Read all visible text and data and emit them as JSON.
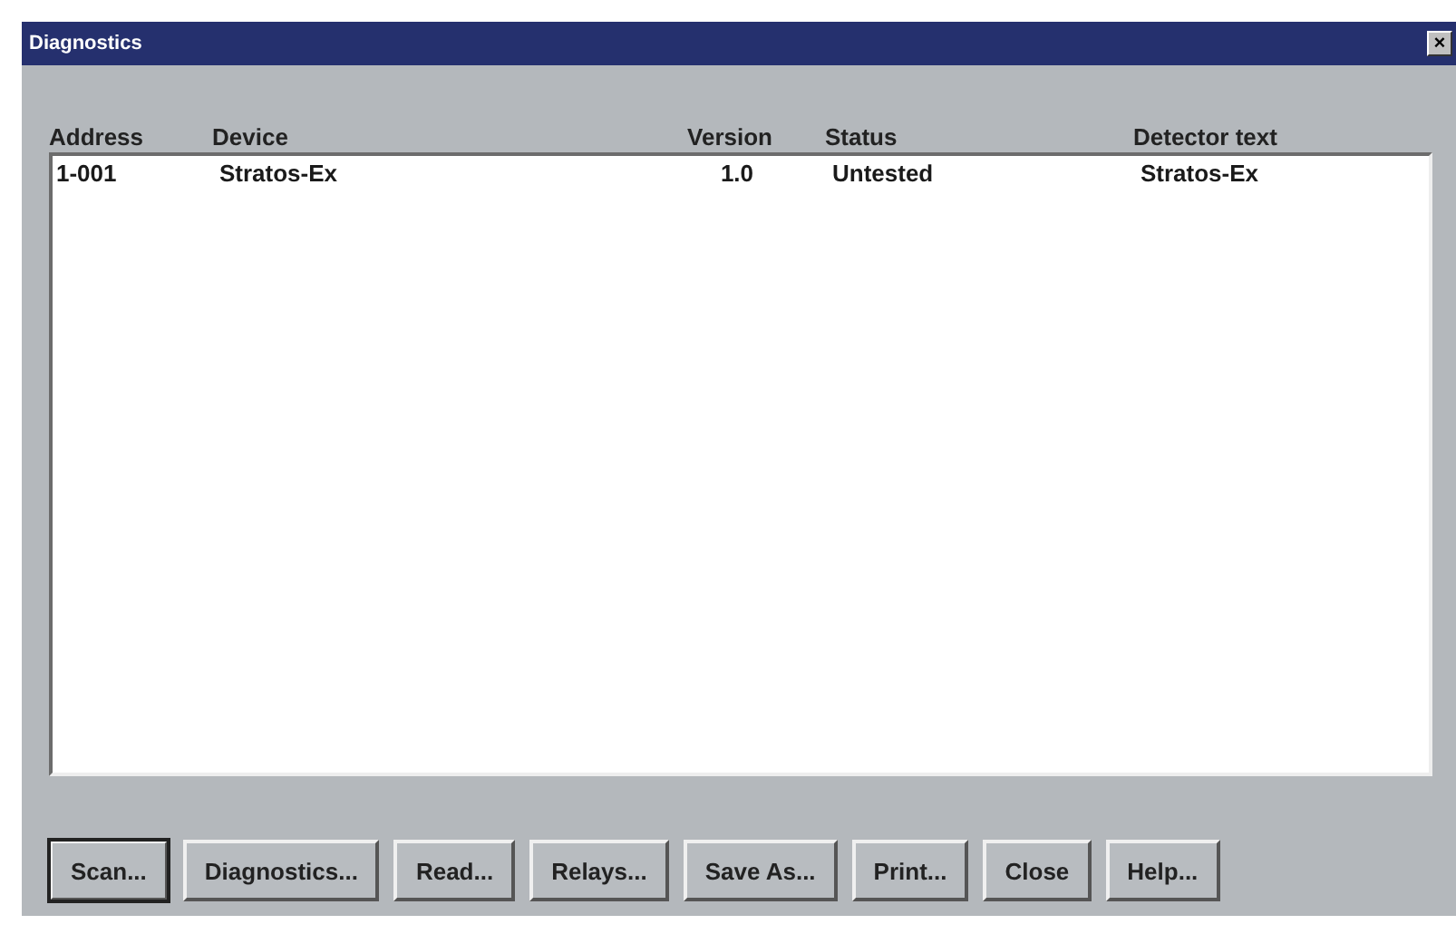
{
  "window": {
    "title": "Diagnostics",
    "close": "×"
  },
  "table": {
    "columns": [
      "Address",
      "Device",
      "Version",
      "Status",
      "Detector text"
    ],
    "rows": [
      {
        "cells": [
          "1-001",
          "Stratos-Ex",
          "1.0",
          "Untested",
          "Stratos-Ex"
        ]
      }
    ]
  },
  "buttons": [
    {
      "label": "Scan...",
      "default": true
    },
    {
      "label": "Diagnostics...",
      "default": false
    },
    {
      "label": "Read...",
      "default": false
    },
    {
      "label": "Relays...",
      "default": false
    },
    {
      "label": "Save As...",
      "default": false
    },
    {
      "label": "Print...",
      "default": false
    },
    {
      "label": "Close",
      "default": false
    },
    {
      "label": "Help...",
      "default": false
    }
  ]
}
